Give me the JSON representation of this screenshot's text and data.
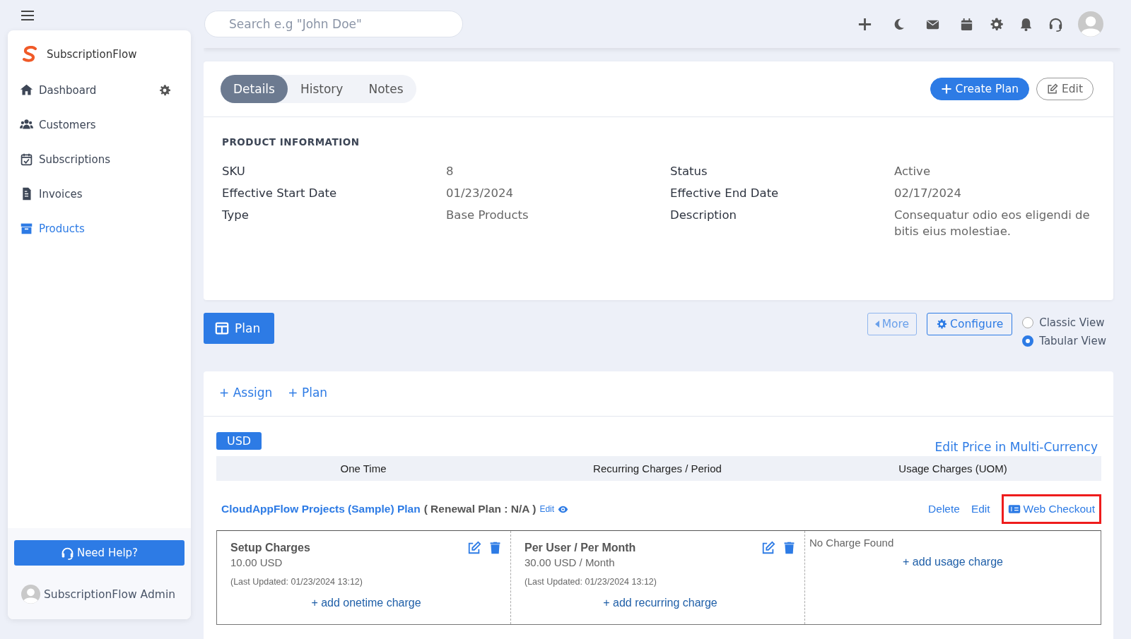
{
  "sidebar": {
    "brand": "SubscriptionFlow",
    "items": [
      {
        "label": "Dashboard",
        "selected": false,
        "settings": true
      },
      {
        "label": "Customers",
        "selected": false,
        "settings": false
      },
      {
        "label": "Subscriptions",
        "selected": false,
        "settings": false
      },
      {
        "label": "Invoices",
        "selected": false,
        "settings": false
      },
      {
        "label": "Products",
        "selected": true,
        "settings": false
      }
    ],
    "help_button": "Need Help?",
    "user": "SubscriptionFlow Admin"
  },
  "topbar": {
    "search": {
      "placeholder": "Search e.g \"John Doe\""
    }
  },
  "tabs": [
    {
      "label": "Details",
      "selected": true
    },
    {
      "label": "History",
      "selected": false
    },
    {
      "label": "Notes",
      "selected": false
    }
  ],
  "actions": [
    {
      "label": "Create Plan",
      "kind": "primary"
    },
    {
      "label": "Edit",
      "kind": "outline"
    }
  ],
  "product_information": {
    "title": "PRODUCT INFORMATION",
    "fields": [
      {
        "label": "SKU",
        "value": "8"
      },
      {
        "label": "Status",
        "value": "Active"
      },
      {
        "label": "Effective Start Date",
        "value": "01/23/2024"
      },
      {
        "label": "Effective End Date",
        "value": "02/17/2024"
      },
      {
        "label": "Type",
        "value": "Base Products"
      },
      {
        "label": "Description",
        "value": "Consequatur odio eos eligendi de bitis eius molestiae."
      }
    ]
  },
  "plan_toolbar": {
    "plan_button": "Plan",
    "more": "More",
    "configure": "Configure",
    "views": [
      {
        "label": "Classic View",
        "selected": false
      },
      {
        "label": "Tabular View",
        "selected": true
      }
    ]
  },
  "plans": {
    "links": [
      "+ Assign",
      "+ Plan"
    ],
    "currency": "USD",
    "multi_currency_link": "Edit Price in Multi-Currency",
    "columns": [
      "One Time",
      "Recurring Charges / Period",
      "Usage Charges (UOM)"
    ],
    "plan": {
      "name": "CloudAppFlow Projects (Sample) Plan",
      "renewal": "( Renewal Plan : N/A )",
      "edit": "Edit",
      "actions": [
        {
          "label": "Delete",
          "highlighted": false
        },
        {
          "label": "Edit",
          "highlighted": false
        },
        {
          "label": "Web Checkout",
          "highlighted": true
        }
      ]
    },
    "charges": [
      {
        "kind": "charge",
        "title": "Setup Charges",
        "price": "10.00 USD",
        "updated": "(Last Updated: 01/23/2024 13:12)",
        "add_link": "+ add onetime charge"
      },
      {
        "kind": "charge",
        "title": "Per User  / Per Month",
        "price": "30.00 USD / Month",
        "updated": "(Last Updated: 01/23/2024 13:12)",
        "add_link": "+ add recurring charge"
      },
      {
        "kind": "empty",
        "message": "No Charge Found",
        "add_link": "+ add usage charge"
      }
    ]
  }
}
